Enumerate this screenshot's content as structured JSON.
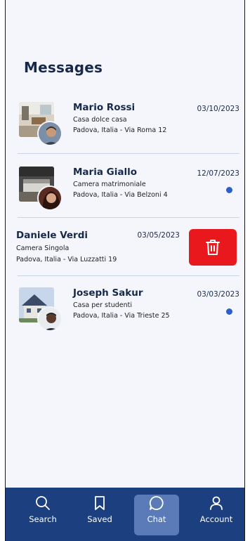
{
  "page": {
    "title": "Messages"
  },
  "conversations": [
    {
      "name": "Mario Rossi",
      "listing": "Casa dolce casa",
      "address": "Padova, Italia - Via Roma 12",
      "date": "03/10/2023",
      "unread": false
    },
    {
      "name": "Maria Giallo",
      "listing": "Camera matrimoniale",
      "address": "Padova, Italia - Via Belzoni 4",
      "date": "12/07/2023",
      "unread": true
    },
    {
      "name": "Daniele Verdi",
      "listing": "Camera Singola",
      "address": "Padova, Italia - Via Luzzatti 19",
      "date": "03/05/2023",
      "unread": false
    },
    {
      "name": "Joseph Sakur",
      "listing": "Casa per studenti",
      "address": "Padova, Italia - Via Trieste 25",
      "date": "03/03/2023",
      "unread": true
    }
  ],
  "delete_action": {
    "icon": "trash-icon",
    "color": "#e8181c"
  },
  "nav": {
    "items": [
      {
        "label": "Search",
        "icon": "search-icon"
      },
      {
        "label": "Saved",
        "icon": "bookmark-icon"
      },
      {
        "label": "Chat",
        "icon": "chat-icon"
      },
      {
        "label": "Account",
        "icon": "user-icon"
      }
    ],
    "active": "Chat"
  },
  "colors": {
    "accent": "#1c3f7f",
    "active_tab": "#5b7bb8",
    "unread_dot": "#2c5fc8",
    "title": "#17294a"
  }
}
